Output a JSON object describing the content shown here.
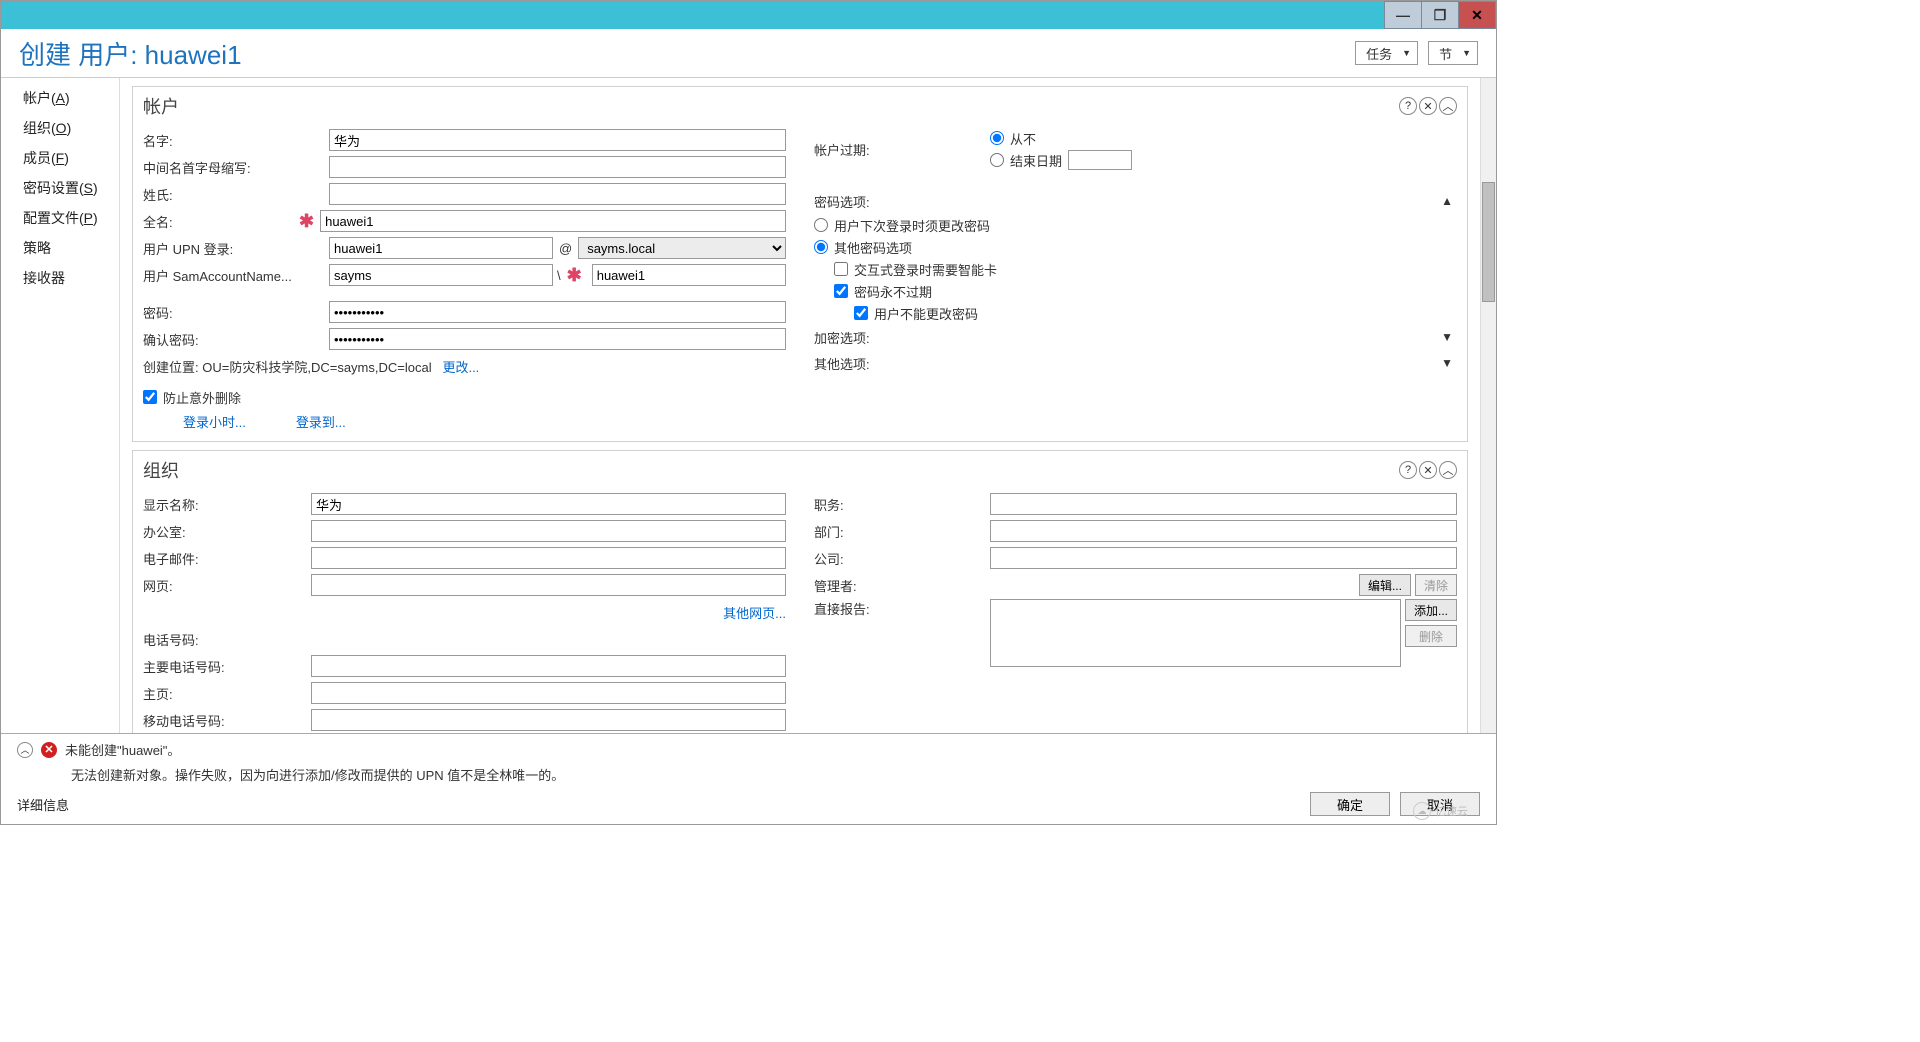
{
  "header": {
    "title": "创建 用户: huawei1",
    "tasks_btn": "任务",
    "sections_btn": "节"
  },
  "sidebar": {
    "items": [
      {
        "label": "帐户",
        "key": "A"
      },
      {
        "label": "组织",
        "key": "O"
      },
      {
        "label": "成员",
        "key": "F"
      },
      {
        "label": "密码设置",
        "key": "S"
      },
      {
        "label": "配置文件",
        "key": "P"
      },
      {
        "label": "策略",
        "key": ""
      },
      {
        "label": "接收器",
        "key": ""
      }
    ]
  },
  "account": {
    "section_title": "帐户",
    "first_name_label": "名字:",
    "first_name": "华为",
    "initials_label": "中间名首字母缩写:",
    "initials": "",
    "last_name_label": "姓氏:",
    "last_name": "",
    "full_name_label": "全名:",
    "full_name": "huawei1",
    "upn_label": "用户 UPN 登录:",
    "upn_user": "huawei1",
    "upn_domain": "sayms.local",
    "sam_label": "用户 SamAccountName...",
    "sam_domain": "sayms",
    "sam_user": "huawei1",
    "password_label": "密码:",
    "password": "***********",
    "confirm_label": "确认密码:",
    "confirm": "***********",
    "create_in_label": "创建位置:",
    "create_in_value": "OU=防灾科技学院,DC=sayms,DC=local",
    "change_link": "更改...",
    "protect_delete": "防止意外删除",
    "logon_hours": "登录小时...",
    "logon_to": "登录到...",
    "expires_label": "帐户过期:",
    "never": "从不",
    "end_date": "结束日期",
    "pwd_options_label": "密码选项:",
    "must_change": "用户下次登录时须更改密码",
    "other_pwd": "其他密码选项",
    "smartcard": "交互式登录时需要智能卡",
    "never_expires": "密码永不过期",
    "cannot_change": "用户不能更改密码",
    "encrypt_label": "加密选项:",
    "other_label": "其他选项:"
  },
  "org": {
    "section_title": "组织",
    "display_name_label": "显示名称:",
    "display_name": "华为",
    "office_label": "办公室:",
    "email_label": "电子邮件:",
    "webpage_label": "网页:",
    "other_web": "其他网页...",
    "phone_label": "电话号码:",
    "main_phone_label": "主要电话号码:",
    "homepage_label": "主页:",
    "mobile_label": "移动电话号码:",
    "title_label": "职务:",
    "dept_label": "部门:",
    "company_label": "公司:",
    "manager_label": "管理者:",
    "edit_btn": "编辑...",
    "clear_btn": "清除",
    "reports_label": "直接报告:",
    "add_btn": "添加...",
    "remove_btn": "删除"
  },
  "footer": {
    "error_title": "未能创建\"huawei\"。",
    "error_detail": "无法创建新对象。操作失败，因为向进行添加/修改而提供的 UPN 值不是全林唯一的。",
    "details_link": "详细信息",
    "ok_btn": "确定",
    "cancel_btn": "取消"
  },
  "watermark": "亿速云"
}
